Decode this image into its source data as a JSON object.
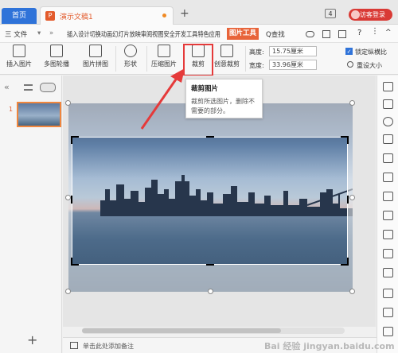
{
  "titlebar": {
    "home_tab": "首页",
    "doc_tab": "演示文稿1",
    "doc_icon_letter": "P",
    "new_tab": "+",
    "window_count": "4",
    "login_button": "访客登录"
  },
  "menubar": {
    "file": "三 文件",
    "file_arrow": "▾",
    "items": [
      "开始",
      "插入",
      "设计",
      "切换",
      "动画",
      "幻灯片放映",
      "审阅",
      "视图",
      "安全",
      "开发工具",
      "特色应用"
    ],
    "active_tab": "图片工具",
    "search": "Q查找",
    "right_icons": [
      "cloud-icon",
      "share-icon",
      "export-icon",
      "help-icon",
      "more-icon",
      "collapse-icon"
    ]
  },
  "ribbon": {
    "insert_picture": "插入图片",
    "multi_outline": "多图轮播",
    "picture_stitch": "图片拼图",
    "shape": "形状",
    "compress": "压缩图片",
    "crop": "裁剪",
    "creative_crop": "创意裁剪",
    "height_label": "高度:",
    "height_value": "15.75厘米",
    "width_label": "宽度:",
    "width_value": "33.96厘米",
    "lock_ratio": "锁定纵横比",
    "reset_size": "重设大小"
  },
  "tooltip": {
    "title": "裁剪图片",
    "body": "裁剪所选图片，删除不需要的部分。"
  },
  "leftpane": {
    "collapse": "«",
    "slide_number": "1",
    "add_slide": "+"
  },
  "statusbar": {
    "notes_placeholder": "单击此处添加备注"
  },
  "watermark": "Bai 经验 jingyan.baidu.com",
  "colors": {
    "accent_blue": "#2f73d9",
    "tab_orange": "#e35b2c",
    "picture_tools": "#e8643a",
    "highlight_red": "#e53a3a"
  }
}
